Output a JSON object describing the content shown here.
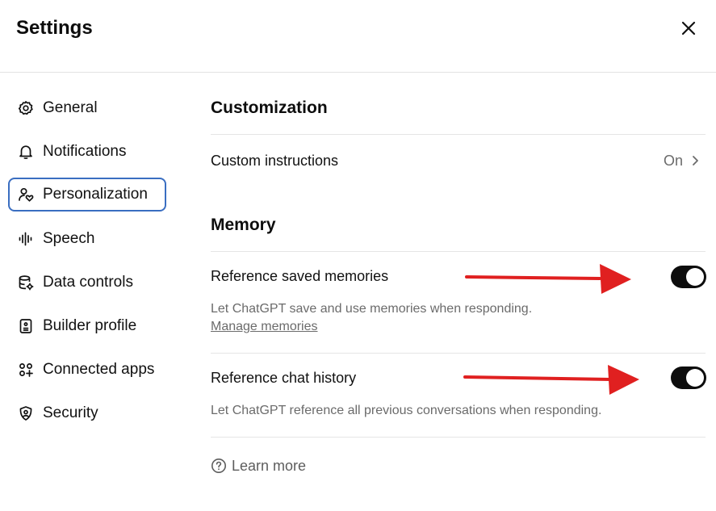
{
  "header": {
    "title": "Settings"
  },
  "sidebar": {
    "items": [
      {
        "label": "General",
        "icon": "gear-icon"
      },
      {
        "label": "Notifications",
        "icon": "bell-icon"
      },
      {
        "label": "Personalization",
        "icon": "person-heart-icon",
        "active": true
      },
      {
        "label": "Speech",
        "icon": "waveform-icon"
      },
      {
        "label": "Data controls",
        "icon": "database-gear-icon"
      },
      {
        "label": "Builder profile",
        "icon": "id-card-icon"
      },
      {
        "label": "Connected apps",
        "icon": "apps-grid-icon"
      },
      {
        "label": "Security",
        "icon": "shield-icon"
      }
    ]
  },
  "main": {
    "customization": {
      "title": "Customization",
      "custom_instructions": {
        "label": "Custom instructions",
        "value": "On"
      }
    },
    "memory": {
      "title": "Memory",
      "saved_memories": {
        "label": "Reference saved memories",
        "description": "Let ChatGPT save and use memories when responding.",
        "link": "Manage memories",
        "enabled": true
      },
      "chat_history": {
        "label": "Reference chat history",
        "description": "Let ChatGPT reference all previous conversations when responding.",
        "enabled": true
      }
    },
    "learn_more": "Learn more"
  },
  "colors": {
    "annotation_arrow": "#e02020",
    "active_outline": "#3a6ec1",
    "toggle_on": "#0d0d0d"
  }
}
